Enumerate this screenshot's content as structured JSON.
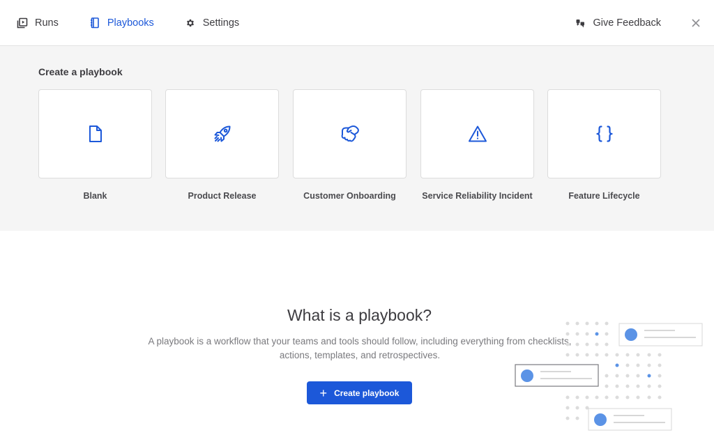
{
  "nav": {
    "items": [
      {
        "label": "Runs",
        "icon": "runs-icon",
        "active": false
      },
      {
        "label": "Playbooks",
        "icon": "playbook-icon",
        "active": true
      },
      {
        "label": "Settings",
        "icon": "gear-icon",
        "active": false
      }
    ],
    "feedback_label": "Give Feedback"
  },
  "templates": {
    "title": "Create a playbook",
    "items": [
      {
        "label": "Blank",
        "icon": "file-icon"
      },
      {
        "label": "Product Release",
        "icon": "rocket-icon"
      },
      {
        "label": "Customer Onboarding",
        "icon": "handshake-icon"
      },
      {
        "label": "Service Reliability Incident",
        "icon": "alert-triangle-icon"
      },
      {
        "label": "Feature Lifecycle",
        "icon": "code-braces-icon"
      }
    ]
  },
  "info": {
    "title": "What is a playbook?",
    "description": "A playbook is a workflow that your teams and tools should follow, including everything from checklists, actions, templates, and retrospectives.",
    "button_label": "Create playbook"
  },
  "colors": {
    "accent": "#1c58d9",
    "panel_bg": "#f5f5f5",
    "text": "#3d3c40",
    "muted_text": "#7a7a7e"
  }
}
